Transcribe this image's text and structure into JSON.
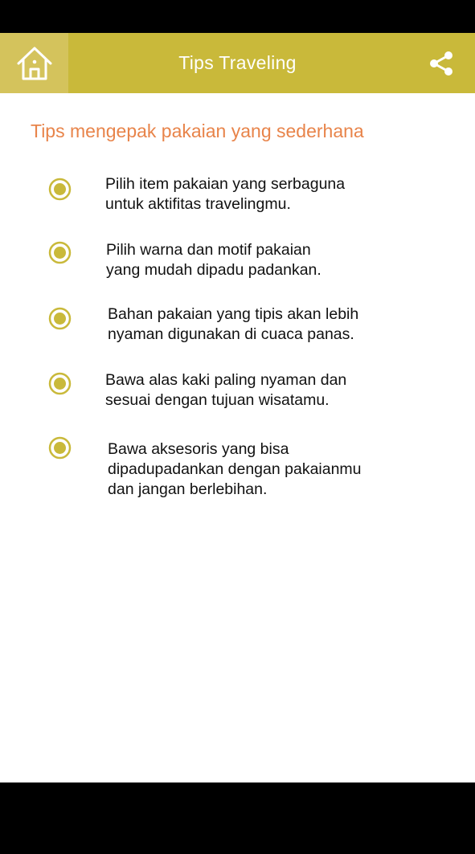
{
  "app_bar": {
    "title": "Tips Traveling",
    "home_icon": "home-icon",
    "share_icon": "share-icon",
    "accent_color": "#c9b93a"
  },
  "section": {
    "title": "Tips mengepak pakaian yang sederhana",
    "title_color": "#e8844a"
  },
  "tips": [
    {
      "text": "Pilih item pakaian yang serbaguna\nuntuk aktifitas  travelingmu."
    },
    {
      "text": "Pilih warna dan motif  pakaian\nyang mudah dipadu padankan."
    },
    {
      "text": "Bahan pakaian yang tipis akan lebih\nnyaman digunakan di cuaca panas."
    },
    {
      "text": "Bawa alas kaki paling nyaman dan\nsesuai dengan tujuan wisatamu."
    },
    {
      "text": "Bawa aksesoris yang bisa\ndipadupadankan dengan pakaianmu\ndan jangan berlebihan."
    }
  ]
}
